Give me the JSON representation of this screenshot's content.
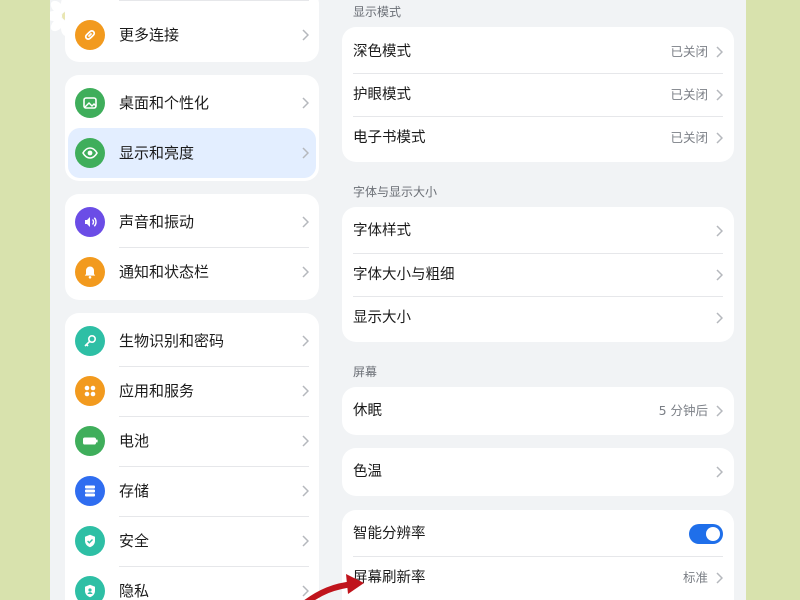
{
  "colors": {
    "background": "#d8e2ad",
    "panel": "#f1f3f5",
    "selected_row": "#e3eeff",
    "toggle_on": "#1f6fea",
    "arrow": "#c0141c"
  },
  "left_menu": {
    "items": [
      {
        "label": "更多连接",
        "icon": "link-icon",
        "color": "#f29a1e"
      },
      {
        "label": "桌面和个性化",
        "icon": "image-icon",
        "color": "#3fae5b"
      },
      {
        "label": "显示和亮度",
        "icon": "eye-icon",
        "color": "#3fae5b",
        "selected": true
      },
      {
        "label": "声音和振动",
        "icon": "speaker-icon",
        "color": "#6b4de6"
      },
      {
        "label": "通知和状态栏",
        "icon": "bell-icon",
        "color": "#f29a1e"
      },
      {
        "label": "生物识别和密码",
        "icon": "key-icon",
        "color": "#2ebfa5"
      },
      {
        "label": "应用和服务",
        "icon": "apps-icon",
        "color": "#f29a1e"
      },
      {
        "label": "电池",
        "icon": "battery-icon",
        "color": "#3fae5b"
      },
      {
        "label": "存储",
        "icon": "storage-icon",
        "color": "#2f6df0"
      },
      {
        "label": "安全",
        "icon": "shield-icon",
        "color": "#2ebfa5"
      },
      {
        "label": "隐私",
        "icon": "privacy-icon",
        "color": "#2ebfa5"
      }
    ]
  },
  "display_mode": {
    "title": "显示模式",
    "rows": [
      {
        "label": "深色模式",
        "value": "已关闭"
      },
      {
        "label": "护眼模式",
        "value": "已关闭"
      },
      {
        "label": "电子书模式",
        "value": "已关闭"
      }
    ]
  },
  "font_size": {
    "title": "字体与显示大小",
    "rows": [
      {
        "label": "字体样式"
      },
      {
        "label": "字体大小与粗细"
      },
      {
        "label": "显示大小"
      }
    ]
  },
  "screen": {
    "title": "屏幕",
    "sleep": {
      "label": "休眠",
      "value": "5 分钟后"
    },
    "color_temp": {
      "label": "色温"
    },
    "smart_resolution": {
      "label": "智能分辨率",
      "enabled": true
    },
    "refresh_rate": {
      "label": "屏幕刷新率",
      "value": "标准"
    }
  }
}
